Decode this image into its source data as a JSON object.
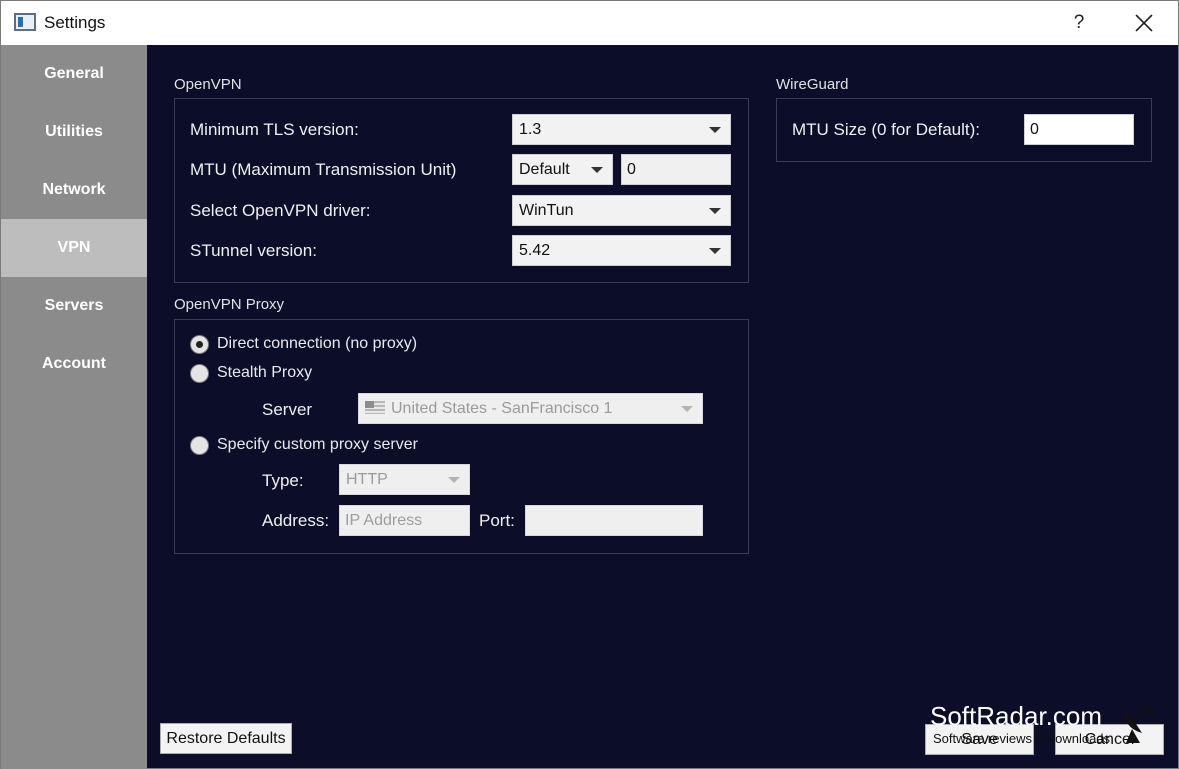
{
  "window": {
    "title": "Settings",
    "help_label": "?"
  },
  "sidebar": {
    "items": [
      {
        "label": "General"
      },
      {
        "label": "Utilities"
      },
      {
        "label": "Network"
      },
      {
        "label": "VPN",
        "active": true
      },
      {
        "label": "Servers"
      },
      {
        "label": "Account"
      }
    ]
  },
  "openvpn": {
    "section_title": "OpenVPN",
    "min_tls_label": "Minimum TLS version:",
    "min_tls_value": "1.3",
    "mtu_label": "MTU (Maximum Transmission Unit)",
    "mtu_mode_value": "Default",
    "mtu_value": "0",
    "driver_label": "Select OpenVPN driver:",
    "driver_value": "WinTun",
    "stunnel_label": "STunnel version:",
    "stunnel_value": "5.42"
  },
  "wireguard": {
    "section_title": "WireGuard",
    "mtu_label": "MTU Size (0 for Default):",
    "mtu_value": "0"
  },
  "proxy": {
    "section_title": "OpenVPN Proxy",
    "direct_label": "Direct connection (no proxy)",
    "stealth_label": "Stealth Proxy",
    "server_label": "Server",
    "server_value": "United States - SanFrancisco 1",
    "custom_label": "Specify custom proxy server",
    "type_label": "Type:",
    "type_value": "HTTP",
    "address_label": "Address:",
    "address_placeholder": "IP Address",
    "port_label": "Port:",
    "port_value": "",
    "selected": "direct"
  },
  "footer": {
    "restore_label": "Restore Defaults",
    "save_label": "Save",
    "cancel_label": "Cancel"
  },
  "watermark": {
    "main": "SoftRadar.com",
    "sub": "Software reviews & downloads"
  },
  "colors": {
    "main_bg": "#0b0d29",
    "sidebar_bg": "#8b8b8b",
    "sidebar_active": "#bdbdbd"
  }
}
